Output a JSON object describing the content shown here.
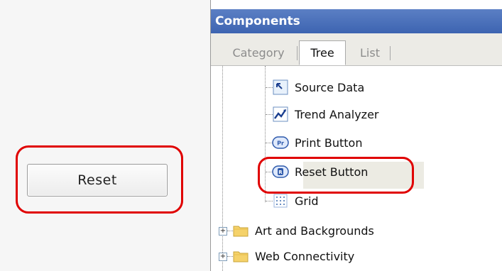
{
  "left": {
    "reset_button_label": "Reset"
  },
  "panel": {
    "title": "Components",
    "tabs": [
      {
        "label": "Category",
        "active": false
      },
      {
        "label": "Tree",
        "active": true
      },
      {
        "label": "List",
        "active": false
      }
    ],
    "tree_items": [
      {
        "label": "Source Data",
        "icon": "source-data-icon"
      },
      {
        "label": "Trend Analyzer",
        "icon": "trend-analyzer-icon"
      },
      {
        "label": "Print Button",
        "icon": "print-button-icon"
      },
      {
        "label": "Reset Button",
        "icon": "reset-button-icon",
        "selected": true
      },
      {
        "label": "Grid",
        "icon": "grid-icon"
      }
    ],
    "folders": [
      {
        "label": "Art and Backgrounds",
        "icon": "folder-icon"
      },
      {
        "label": "Web Connectivity",
        "icon": "folder-icon"
      }
    ]
  },
  "colors": {
    "header_blue": "#4a70bb",
    "highlight_red": "#e00000"
  }
}
